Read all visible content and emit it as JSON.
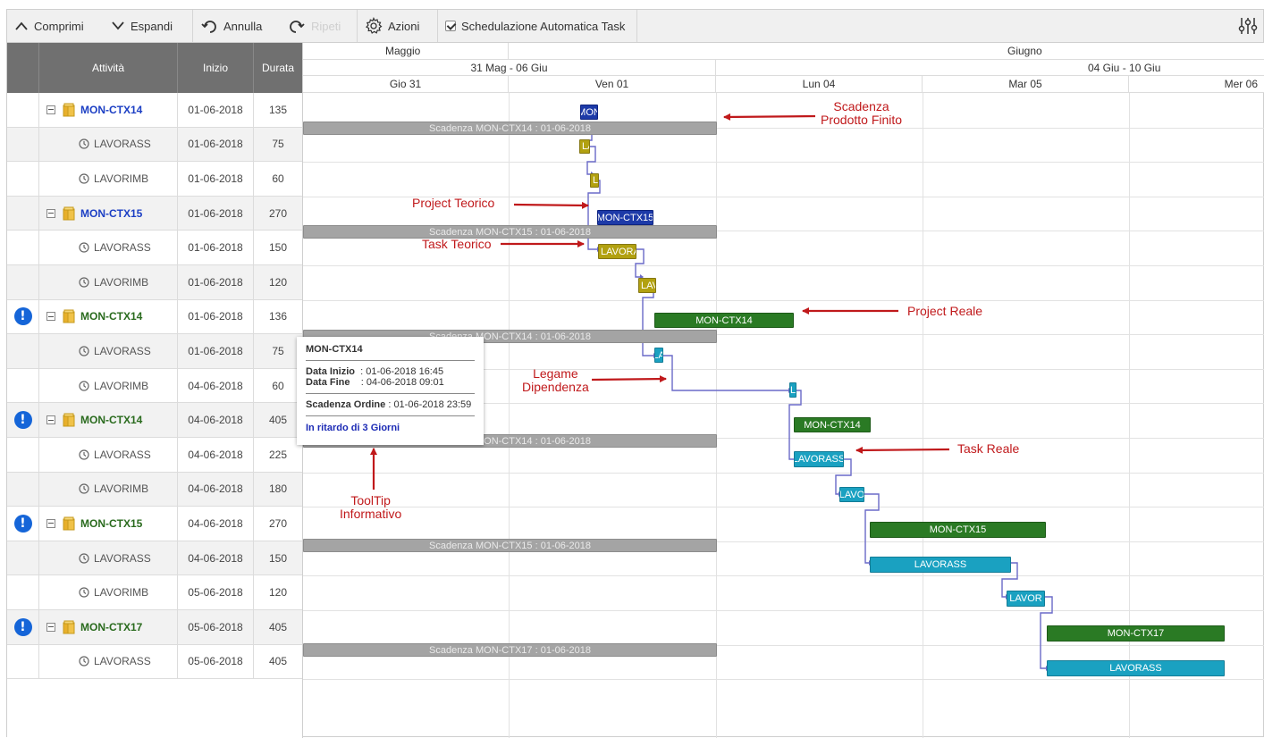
{
  "toolbar": {
    "collapse": "Comprimi",
    "expand": "Espandi",
    "undo": "Annulla",
    "redo": "Ripeti",
    "actions": "Azioni",
    "auto_schedule": "Schedulazione Automatica Task"
  },
  "grid": {
    "columns": {
      "activity": "Attività",
      "start": "Inizio",
      "duration": "Durata"
    },
    "rows": [
      {
        "name": "MON-CTX14",
        "start": "01-06-2018",
        "duration": "135",
        "type": "parent",
        "style": "theoretical",
        "alert": false
      },
      {
        "name": "LAVORASS",
        "start": "01-06-2018",
        "duration": "75",
        "type": "child"
      },
      {
        "name": "LAVORIMB",
        "start": "01-06-2018",
        "duration": "60",
        "type": "child"
      },
      {
        "name": "MON-CTX15",
        "start": "01-06-2018",
        "duration": "270",
        "type": "parent",
        "style": "theoretical",
        "alert": false
      },
      {
        "name": "LAVORASS",
        "start": "01-06-2018",
        "duration": "150",
        "type": "child"
      },
      {
        "name": "LAVORIMB",
        "start": "01-06-2018",
        "duration": "120",
        "type": "child"
      },
      {
        "name": "MON-CTX14",
        "start": "01-06-2018",
        "duration": "136",
        "type": "parent",
        "style": "real",
        "alert": true
      },
      {
        "name": "LAVORASS",
        "start": "01-06-2018",
        "duration": "75",
        "type": "child"
      },
      {
        "name": "LAVORIMB",
        "start": "04-06-2018",
        "duration": "60",
        "type": "child"
      },
      {
        "name": "MON-CTX14",
        "start": "04-06-2018",
        "duration": "405",
        "type": "parent",
        "style": "real",
        "alert": true
      },
      {
        "name": "LAVORASS",
        "start": "04-06-2018",
        "duration": "225",
        "type": "child"
      },
      {
        "name": "LAVORIMB",
        "start": "04-06-2018",
        "duration": "180",
        "type": "child"
      },
      {
        "name": "MON-CTX15",
        "start": "04-06-2018",
        "duration": "270",
        "type": "parent",
        "style": "real",
        "alert": true
      },
      {
        "name": "LAVORASS",
        "start": "04-06-2018",
        "duration": "150",
        "type": "child"
      },
      {
        "name": "LAVORIMB",
        "start": "05-06-2018",
        "duration": "120",
        "type": "child"
      },
      {
        "name": "MON-CTX17",
        "start": "05-06-2018",
        "duration": "405",
        "type": "parent",
        "style": "real",
        "alert": true
      },
      {
        "name": "LAVORASS",
        "start": "05-06-2018",
        "duration": "405",
        "type": "child"
      }
    ]
  },
  "timeline": {
    "months": [
      "Maggio",
      "Giugno"
    ],
    "weeks": [
      "31 Mag - 06 Giu",
      "04 Giu - 10 Giu"
    ],
    "days": [
      "Gio 31",
      "Ven 01",
      "Lun 04",
      "Mar 05",
      "Mer 06"
    ]
  },
  "bars": {
    "deadline_1": "Scadenza MON-CTX14 : 01-06-2018",
    "deadline_2": "Scadenza MON-CTX15 : 01-06-2018",
    "deadline_3": "Scadenza MON-CTX14 : 01-06-2018",
    "deadline_4": "Scadenza MON-CTX14 : 01-06-2018",
    "deadline_5": "Scadenza MON-CTX15 : 01-06-2018",
    "deadline_6": "Scadenza MON-CTX17 : 01-06-2018",
    "teo_proj_1": "MON",
    "teo_task_1": "LA",
    "teo_task_2": "L",
    "teo_proj_2": "MON-CTX15",
    "teo_task_3": "LAVORA",
    "teo_task_4": "LAV",
    "real_proj_1": "MON-CTX14",
    "real_task_1": "LA",
    "real_task_2": "L",
    "real_proj_2": "MON-CTX14",
    "real_task_3": "LAVORASS",
    "real_task_4": "LAVO",
    "real_proj_3": "MON-CTX15",
    "real_task_5": "LAVORASS",
    "real_task_6": "LAVOR",
    "real_proj_4": "MON-CTX17",
    "real_task_7": "LAVORASS"
  },
  "annotations": {
    "deadline": "Scadenza\nProdotto Finito",
    "project_theoretical": "Project Teorico",
    "task_theoretical": "Task Teorico",
    "project_real": "Project Reale",
    "dependency": "Legame\nDipendenza",
    "task_real": "Task Reale",
    "tooltip": "ToolTip\nInformativo"
  },
  "tooltip": {
    "title": "MON-CTX14",
    "start_label": "Data Inizio",
    "start_value": ": 01-06-2018 16:45",
    "end_label": "Data Fine",
    "end_value": ": 04-06-2018 09:01",
    "deadline_label": "Scadenza Ordine",
    "deadline_value": ": 01-06-2018 23:59",
    "late": "In ritardo di 3 Giorni"
  },
  "colors": {
    "theoretical_project": "#1d3aa8",
    "theoretical_task": "#b2a110",
    "real_project": "#2a7a24",
    "real_task": "#1aa1c1",
    "deadline": "#a4a4a4",
    "annotation": "#c0191b",
    "dependency_link": "#6a6ac8",
    "alert": "#1565d8",
    "theoretical_name": "#1c3fc4",
    "real_name": "#2a6b1e"
  }
}
